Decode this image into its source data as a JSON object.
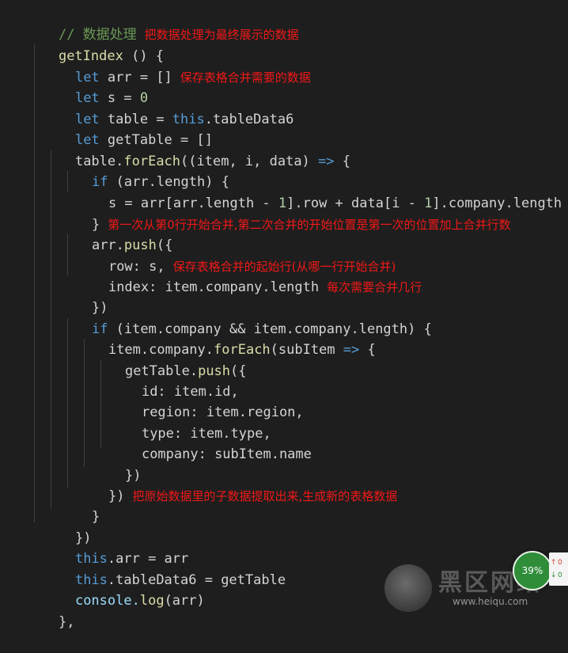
{
  "code": {
    "comment_line": "// 数据处理",
    "note_header": "把数据处理为最终展示的数据",
    "func_name": "getIndex",
    "func_sig": " () {",
    "kw_let": "let",
    "kw_if": "if",
    "kw_this": "this",
    "arr_decl": " arr = []",
    "note_arr": "保存表格合并需要的数据",
    "s_decl_pre": " s = ",
    "s_value": "0",
    "table_decl_pre": " table = ",
    "table_decl_post": ".tableData6",
    "gettable_decl": " getTable = []",
    "foreach_obj": "table.",
    "foreach_fn": "forEach",
    "foreach_args_pre": "((item, i, data) ",
    "arrow": "=>",
    "foreach_args_post": " {",
    "if1_cond": " (arr.length) {",
    "assign_s_pre": "s = arr[arr.length - ",
    "one": "1",
    "assign_s_mid": "].row + data[i - ",
    "assign_s_post": "].company.length",
    "close_if": "}",
    "note_close_if": "第一次从第0行开始合并,第二次合并的开始位置是第一次的位置加上合并行数",
    "arrpush_obj": "arr.",
    "push_fn": "push",
    "push_open": "({",
    "row_line": "row: s,",
    "note_row": "保存表格合并的起始行(从哪一行开始合并)",
    "index_line": "index: item.company.length",
    "note_index": "每次需要合并几行",
    "close_paren": "})",
    "if2_cond": " (item.company && item.company.length) {",
    "foreach2_obj": "item.company.",
    "foreach2_args_pre": "(subItem ",
    "foreach2_args_post": " {",
    "gettable_obj": "getTable.",
    "id_line": "id: item.id,",
    "region_line": "region: item.region,",
    "type_line": "type: item.type,",
    "company_line": "company: subItem.name",
    "close_paren_inner": "})",
    "close_double": "})",
    "note_double": "把原始数据里的子数据提取出来,生成新的表格数据",
    "close_brace": "}",
    "close_foreach": "})",
    "arr_assign": ".arr = arr",
    "td_assign": ".tableData6 = getTable",
    "console_obj": "console.",
    "log_fn": "log",
    "log_args": "(arr)",
    "end_func": "},"
  },
  "overlay": {
    "watermark_title": "黑区网络",
    "watermark_url": "www.heiqu.com",
    "speed_label": "39%",
    "net_up": "0",
    "net_down": "0"
  },
  "colors": {
    "background": "#1e1e1e",
    "keyword": "#569cd6",
    "function": "#dcdcaa",
    "comment": "#6a9955",
    "number": "#b5cea8",
    "annotation": "#f01818"
  }
}
